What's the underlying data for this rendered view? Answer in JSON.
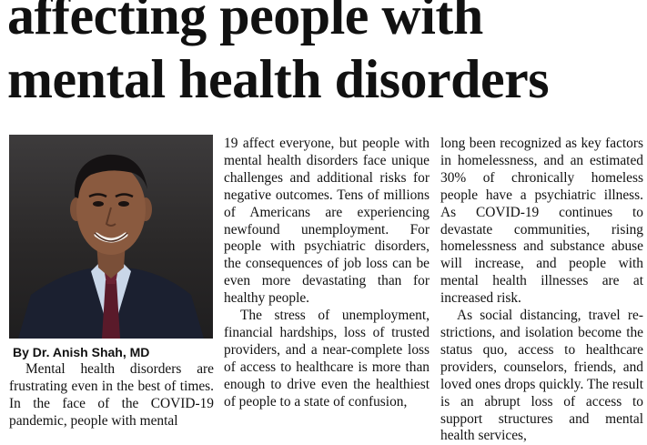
{
  "headline": {
    "line1": "affecting people with",
    "line2": "mental health disorders"
  },
  "photo": {
    "alt": "Dr. Anish Shah"
  },
  "byline": "By Dr. Anish Shah, MD",
  "column1": {
    "p1": "Mental health disorders are frustrating even in the best of times. In the face of the COVID-19 pandemic, people with mental"
  },
  "column2": {
    "p1": "19 affect everyone, but people with mental health disorders face unique challenges and additional risks for negative outcomes. Tens of millions of Americans are experiencing newfound un­em­ploy­ment. For people with psychiatric disorders, the conse­quences of job loss can be even more devastating than for healthy people.",
    "p2": "The stress of unemployment, financial hardships, loss of trusted providers, and a near-complete loss of access to healthcare is more than enough to drive even the healthiest of people to a state of confusion,"
  },
  "column3": {
    "p1": "long been recognized as key fac­tors in homelessness, and an es­timated 30% of chronically homeless people have a psychi­atric illness. As COVID-19 con­tinues to devastate communities, rising homelessness and sub­stance abuse will increase, and people with mental health ill­nesses are at increased risk.",
    "p2": "As social distancing, travel re­strictions, and isolation become the status quo, access to health­care providers, counselors, friends, and loved ones drops quickly. The result is an abrupt loss of access to support struc­tures and mental health services,"
  }
}
